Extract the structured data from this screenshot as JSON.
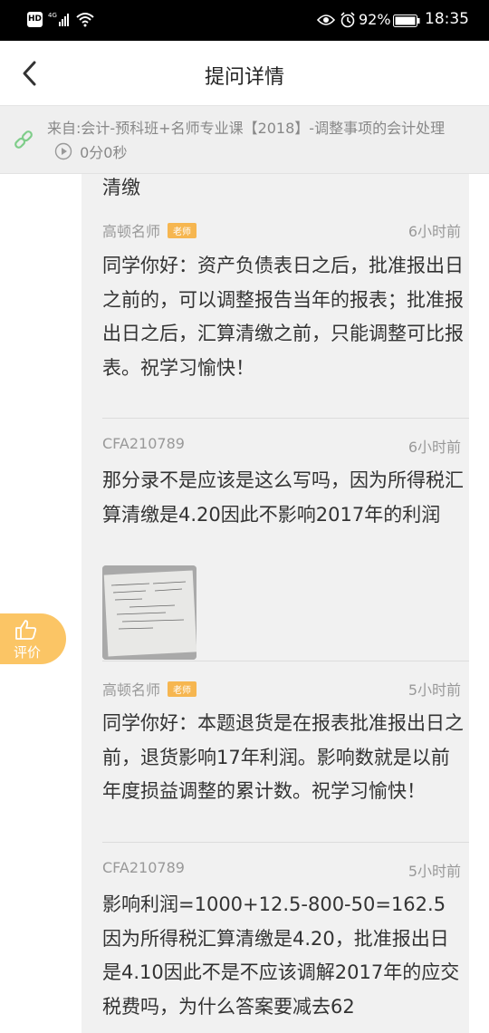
{
  "status_bar": {
    "hd": "HD",
    "signal": "4G",
    "battery": "92%",
    "time": "18:35"
  },
  "header": {
    "title": "提问详情"
  },
  "source": {
    "text": "来自:会计-预科班+名师专业课【2018】-调整事项的会计处理",
    "duration": "0分0秒"
  },
  "thread": {
    "partial_text": "清缴",
    "messages": [
      {
        "author": "高顿名师",
        "badge": "老师",
        "time": "6小时前",
        "text": "同学你好：资产负债表日之后，批准报出日之前的，可以调整报告当年的报表；批准报出日之后，汇算清缴之前，只能调整可比报表。祝学习愉快！"
      },
      {
        "author": "CFA210789",
        "time": "6小时前",
        "text": "那分录不是应该是这么写吗，因为所得税汇算清缴是4.20因此不影响2017年的利润"
      },
      {
        "author": "高顿名师",
        "badge": "老师",
        "time": "5小时前",
        "text": "同学你好：本题退货是在报表批准报出日之前，退货影响17年利润。影响数就是以前年度损益调整的累计数。祝学习愉快！"
      },
      {
        "author": "CFA210789",
        "time": "5小时前",
        "text": "影响利润=1000+12.5-800-50=162.5因为所得税汇算清缴是4.20，批准报出日是4.10因此不是不应该调解2017年的应交税费吗，为什么答案要减去62"
      }
    ]
  },
  "rate_button": {
    "label": "评价"
  },
  "colors": {
    "badge": "#f6b650",
    "rate_button": "#fbc565",
    "thread_bg": "#f1f1f1",
    "link_icon": "#7fcd8a"
  }
}
